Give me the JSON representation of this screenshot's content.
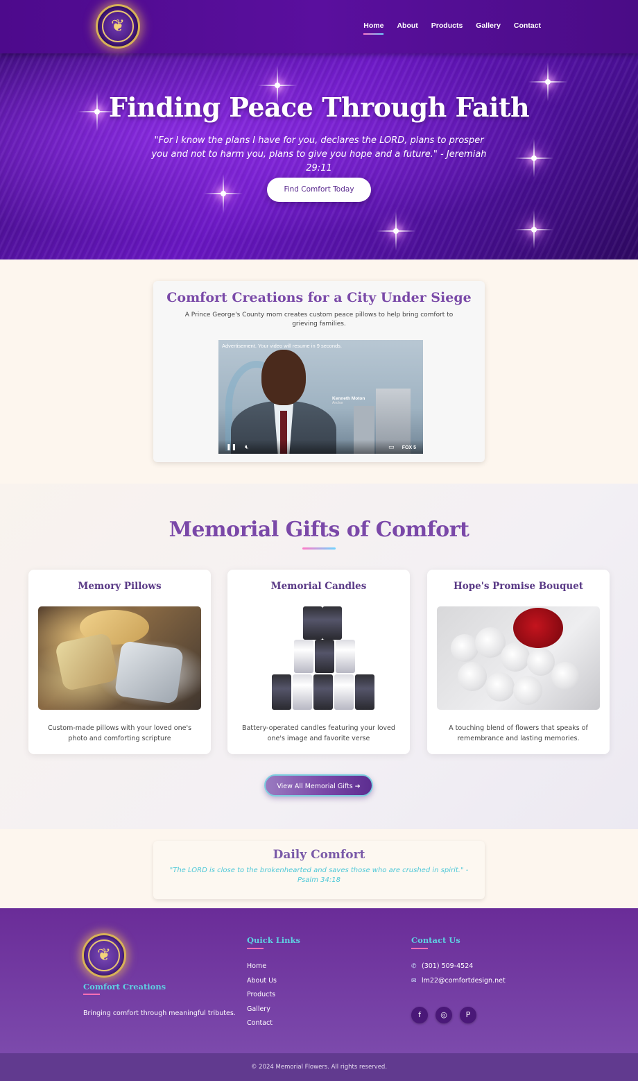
{
  "nav": {
    "logo_icon": "dove-heart-emblem-icon",
    "links": [
      {
        "label": "Home",
        "active": true
      },
      {
        "label": "About",
        "active": false
      },
      {
        "label": "Products",
        "active": false
      },
      {
        "label": "Gallery",
        "active": false
      },
      {
        "label": "Contact",
        "active": false
      }
    ]
  },
  "hero": {
    "title": "Finding Peace Through Faith",
    "verse": "\"For I know the plans I have for you, declares the LORD, plans to prosper you and not to harm you, plans to give you hope and a future.\" - Jeremiah 29:11",
    "cta_label": "Find Comfort Today"
  },
  "feature": {
    "title": "Comfort Creations for a City Under Siege",
    "description": "A Prince George's County mom creates custom peace pillows to help bring comfort to grieving families.",
    "video": {
      "ad_text": "Advertisement. Your video will resume in 9 seconds.",
      "lower_third_name": "Kenneth Moton",
      "lower_third_role": "Anchor",
      "network": "FOX 5"
    }
  },
  "gifts": {
    "title": "Memorial Gifts of Comfort",
    "cards": [
      {
        "title": "Memory Pillows",
        "description": "Custom-made pillows with your loved one's photo and comforting scripture"
      },
      {
        "title": "Memorial Candles",
        "description": "Battery-operated candles featuring your loved one's image and favorite verse"
      },
      {
        "title": "Hope's Promise Bouquet",
        "description": "A touching blend of flowers that speaks of remembrance and lasting memories."
      }
    ],
    "button_label": "View All Memorial Gifts ➔"
  },
  "daily": {
    "title": "Daily Comfort",
    "verse": "\"The LORD is close to the brokenhearted and saves those who are crushed in spirit.\" - Psalm 34:18"
  },
  "footer": {
    "brand": "Comfort Creations",
    "tagline": "Bringing comfort through meaningful tributes.",
    "quick_links_title": "Quick Links",
    "quick_links": [
      "Home",
      "About Us",
      "Products",
      "Gallery",
      "Contact"
    ],
    "contact_title": "Contact Us",
    "phone": "(301) 509-4524",
    "email": "lm22@comfortdesign.net",
    "socials": [
      "facebook-icon",
      "instagram-icon",
      "pinterest-icon"
    ],
    "copyright": "© 2024 Memorial Flowers. All rights reserved."
  },
  "colors": {
    "primary_purple": "#5a0f9e",
    "heading_purple": "#7a48a8",
    "accent_teal": "#5fd0e2",
    "accent_pink": "#ff7ac8"
  }
}
